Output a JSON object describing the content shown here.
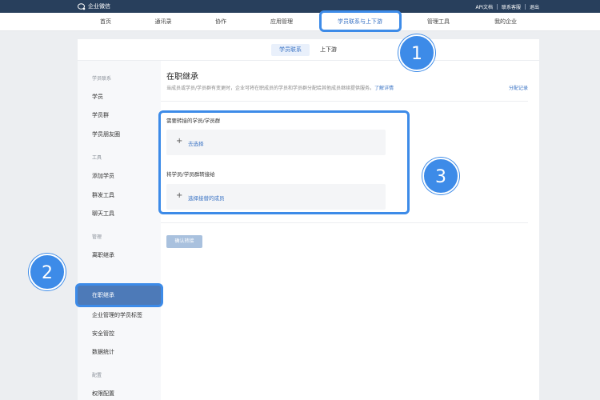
{
  "topbar": {
    "logo_text": "企业微信",
    "links": [
      "API文档",
      "联系客服",
      "退出"
    ]
  },
  "nav": {
    "items": [
      "首页",
      "通讯录",
      "协作",
      "应用管理",
      "学员联系与上下游",
      "管理工具",
      "我的企业"
    ],
    "active_index": 4
  },
  "subtabs": {
    "items": [
      "学员联系",
      "上下游"
    ],
    "active_index": 0
  },
  "sidebar": {
    "groups": [
      {
        "title": "学员联系",
        "items": [
          "学员",
          "学员群",
          "学员朋友圈"
        ]
      },
      {
        "title": "工具",
        "items": [
          "添加学员",
          "群发工具",
          "聊天工具"
        ]
      },
      {
        "title": "管理",
        "items": [
          "离职继承",
          "在职继承",
          "企业管理的学员标签",
          "安全管控",
          "数据统计"
        ]
      },
      {
        "title": "配置",
        "items": [
          "权限配置"
        ]
      }
    ],
    "active_item": "在职继承"
  },
  "main": {
    "title": "在职继承",
    "description": "当成员或学员/学员群有变更时，企业可将在职成员的学员和学员群分配给其他成员继续提供服务。",
    "learn_more": "了解详情",
    "log_link": "分配记录",
    "section1_label": "需要转接的学员/学员群",
    "section1_button": "去选择",
    "section2_label": "将学员/学员群转接给",
    "section2_button": "选择接替的成员",
    "confirm_button": "确认转接"
  },
  "annotations": {
    "badge_1": "1",
    "badge_2": "2",
    "badge_3": "3"
  },
  "colors": {
    "topbar": "#283f5c",
    "accent": "#3a73c4",
    "highlight": "#3d8be8",
    "sidebar_active": "#4d7ab8"
  }
}
